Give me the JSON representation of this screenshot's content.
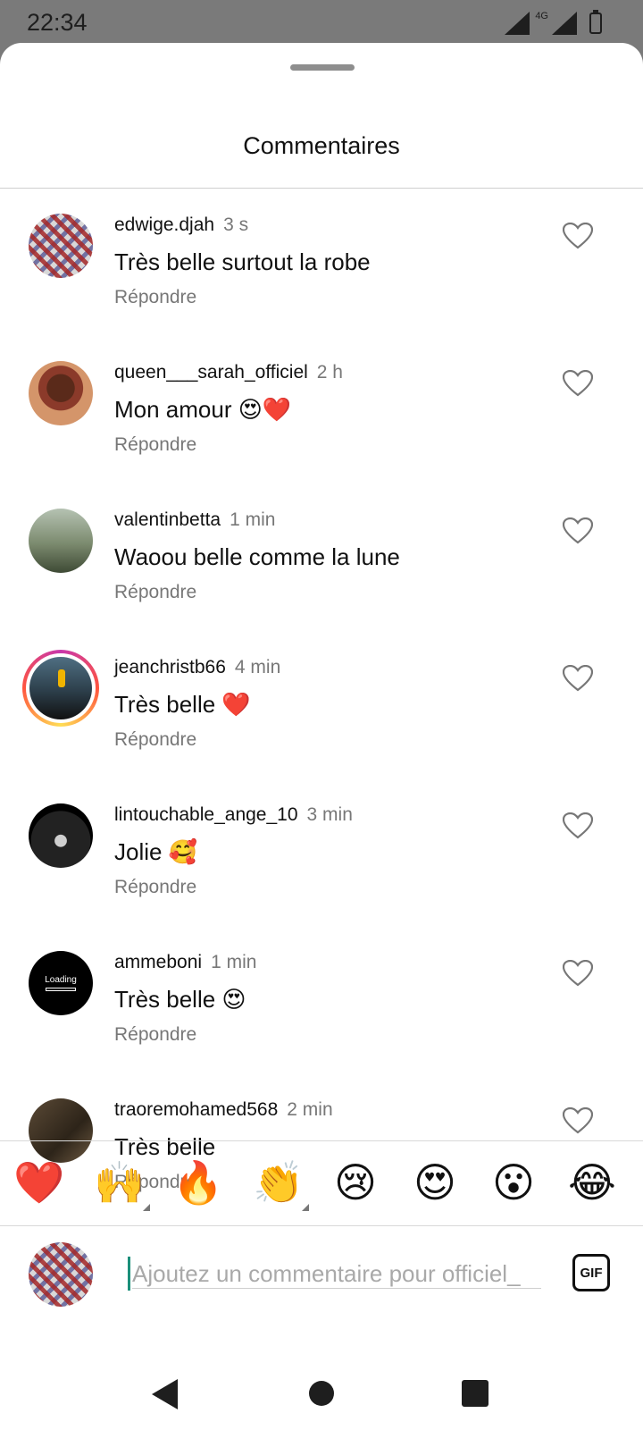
{
  "status_bar": {
    "time": "22:34",
    "network": "4G",
    "icons": [
      "signal-icon",
      "mobile-signal-icon",
      "battery-charging-icon"
    ]
  },
  "sheet": {
    "title": "Commentaires"
  },
  "comments": [
    {
      "username": "edwige.djah",
      "time": "3 s",
      "text": "Très belle surtout la robe",
      "reply": "Répondre",
      "avatar": "patterned-avatar",
      "like_icon": "heart-outline-icon"
    },
    {
      "username": "queen___sarah_officiel",
      "time": "2 h",
      "text": "Mon amour 😍❤️",
      "reply": "Répondre",
      "avatar": "woman-portrait-avatar",
      "like_icon": "heart-outline-icon"
    },
    {
      "username": "valentinbetta",
      "time": "1 min",
      "text": "Waoou belle comme la lune",
      "reply": "Répondre",
      "avatar": "field-photo-avatar",
      "like_icon": "heart-outline-icon"
    },
    {
      "username": "jeanchristb66",
      "time": "4 min",
      "text": "Très belle ❤️",
      "reply": "Répondre",
      "avatar": "story-ring-avatar",
      "like_icon": "heart-outline-icon"
    },
    {
      "username": "lintouchable_ange_10",
      "time": "3 min",
      "text": "Jolie 🥰",
      "reply": "Répondre",
      "avatar": "dark-avatar",
      "like_icon": "heart-outline-icon"
    },
    {
      "username": "ammeboni",
      "time": "1 min",
      "text": "Très belle 😍",
      "reply": "Répondre",
      "avatar": "loading-avatar",
      "avatar_text": "Loading",
      "like_icon": "heart-outline-icon"
    },
    {
      "username": "traoremohamed568",
      "time": "2 min",
      "text": "Très belle",
      "reply": "Répondre",
      "avatar": "tree-avatar",
      "like_icon": "heart-outline-icon"
    }
  ],
  "emoji_bar": [
    "❤️",
    "🙌",
    "🔥",
    "👏",
    "😢",
    "😍",
    "😮",
    "😂"
  ],
  "composer": {
    "placeholder": "Ajoutez un commentaire pour officiel_",
    "gif_label": "GIF"
  },
  "nav_bar": {
    "icons": [
      "back-icon",
      "home-icon",
      "recents-icon"
    ]
  },
  "colors": {
    "accent_caret": "#1b8f7a",
    "muted_text": "#777777",
    "statusbar_bg": "#7a7a7a"
  }
}
